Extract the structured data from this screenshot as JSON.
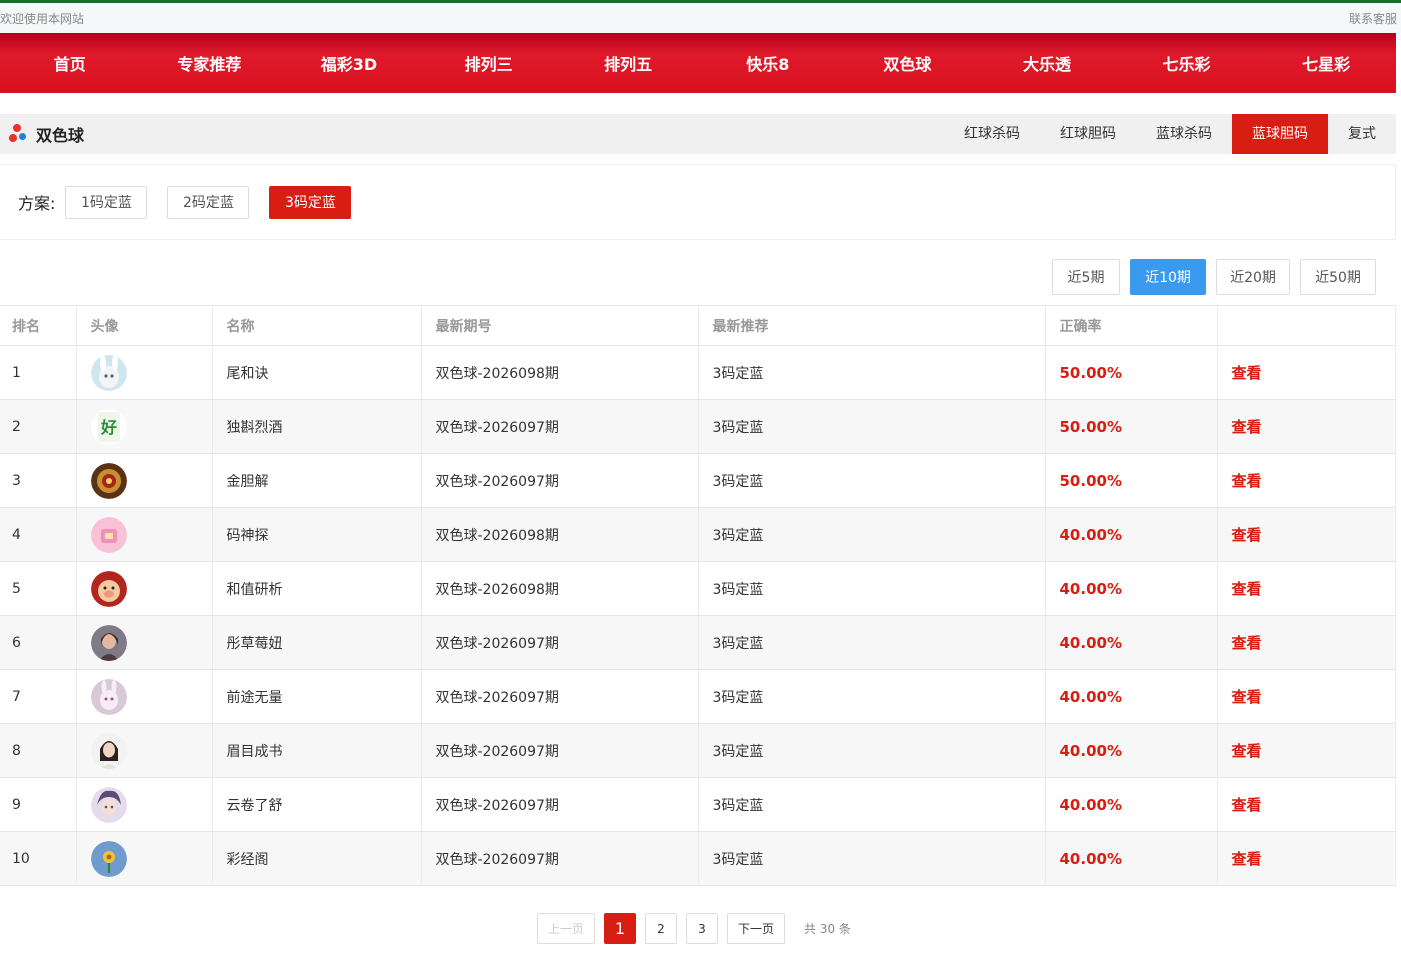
{
  "topbar": {
    "welcome": "欢迎使用本网站",
    "contact": "联系客服"
  },
  "nav": [
    "首页",
    "专家推荐",
    "福彩3D",
    "排列三",
    "排列五",
    "快乐8",
    "双色球",
    "大乐透",
    "七乐彩",
    "七星彩"
  ],
  "section": {
    "title": "双色球",
    "tabs": [
      "红球杀码",
      "红球胆码",
      "蓝球杀码",
      "蓝球胆码",
      "复式"
    ],
    "active_tab": "蓝球胆码"
  },
  "plan": {
    "label": "方案:",
    "options": [
      "1码定蓝",
      "2码定蓝",
      "3码定蓝"
    ],
    "active": "3码定蓝"
  },
  "periods": {
    "options": [
      "近5期",
      "近10期",
      "近20期",
      "近50期"
    ],
    "active": "近10期"
  },
  "table": {
    "headers": [
      "排名",
      "头像",
      "名称",
      "最新期号",
      "最新推荐",
      "正确率",
      ""
    ],
    "rows": [
      {
        "rank": "1",
        "avatar": "rabbit-avatar",
        "name": "尾和诀",
        "issue": "双色球-2026098期",
        "rec": "3码定蓝",
        "rate": "50.00%",
        "action": "查看"
      },
      {
        "rank": "2",
        "avatar": "hao-avatar",
        "name": "独斟烈酒",
        "issue": "双色球-2026097期",
        "rec": "3码定蓝",
        "rate": "50.00%",
        "action": "查看"
      },
      {
        "rank": "3",
        "avatar": "medal-avatar",
        "name": "金胆解",
        "issue": "双色球-2026097期",
        "rec": "3码定蓝",
        "rate": "50.00%",
        "action": "查看"
      },
      {
        "rank": "4",
        "avatar": "pink-avatar",
        "name": "码神探",
        "issue": "双色球-2026098期",
        "rec": "3码定蓝",
        "rate": "40.00%",
        "action": "查看"
      },
      {
        "rank": "5",
        "avatar": "pig-avatar",
        "name": "和值研析",
        "issue": "双色球-2026098期",
        "rec": "3码定蓝",
        "rate": "40.00%",
        "action": "查看"
      },
      {
        "rank": "6",
        "avatar": "girl-avatar",
        "name": "彤草莓妞",
        "issue": "双色球-2026097期",
        "rec": "3码定蓝",
        "rate": "40.00%",
        "action": "查看"
      },
      {
        "rank": "7",
        "avatar": "bunny-avatar",
        "name": "前途无量",
        "issue": "双色球-2026097期",
        "rec": "3码定蓝",
        "rate": "40.00%",
        "action": "查看"
      },
      {
        "rank": "8",
        "avatar": "woman-avatar",
        "name": "眉目成书",
        "issue": "双色球-2026097期",
        "rec": "3码定蓝",
        "rate": "40.00%",
        "action": "查看"
      },
      {
        "rank": "9",
        "avatar": "anime-avatar",
        "name": "云卷了舒",
        "issue": "双色球-2026097期",
        "rec": "3码定蓝",
        "rate": "40.00%",
        "action": "查看"
      },
      {
        "rank": "10",
        "avatar": "flower-avatar",
        "name": "彩经阁",
        "issue": "双色球-2026097期",
        "rec": "3码定蓝",
        "rate": "40.00%",
        "action": "查看"
      }
    ]
  },
  "pager": {
    "prev": "上一页",
    "pages": [
      "1",
      "2",
      "3"
    ],
    "current": "1",
    "next": "下一页",
    "total": "共 30 条"
  },
  "colors": {
    "accent_red": "#d81d12",
    "nav_red": "#df1a2a",
    "active_blue": "#3a9af0"
  }
}
